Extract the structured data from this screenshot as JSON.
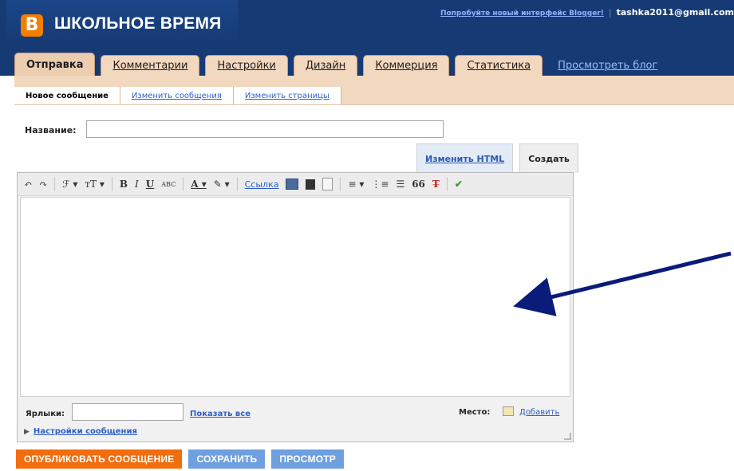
{
  "header": {
    "logo_letter": "B",
    "blog_title": "ШКОЛЬНОЕ ВРЕМЯ",
    "try_new_label": "Попробуйте новый интерфейс Blogger!",
    "separator": "|",
    "account_email": "tashka2011@gmail.com"
  },
  "tabs": [
    {
      "label": "Отправка",
      "active": true
    },
    {
      "label": "Комментарии"
    },
    {
      "label": "Настройки"
    },
    {
      "label": "Дизайн"
    },
    {
      "label": "Коммерция"
    },
    {
      "label": "Статистика"
    }
  ],
  "view_blog_label": "Просмотреть блог",
  "subtabs": [
    {
      "label": "Новое сообщение",
      "active": true
    },
    {
      "label": "Изменить сообщения"
    },
    {
      "label": "Изменить страницы"
    }
  ],
  "form": {
    "title_label": "Название:",
    "title_value": "",
    "mode_html_label": "Изменить HTML",
    "mode_compose_label": "Создать"
  },
  "toolbar": {
    "undo": "↶",
    "redo": "↷",
    "font": "ℱ ▾",
    "font_size": "тT ▾",
    "bold": "B",
    "italic": "I",
    "underline": "U",
    "strike": "ABC",
    "text_color": "A ▾",
    "highlight": "✎ ▾",
    "link_label": "Ссылка",
    "align": "≡ ▾",
    "ordered_list": "⋮≡",
    "unordered_list": "☰",
    "quote": "66",
    "remove_format": "T̶",
    "spellcheck": "✔"
  },
  "labels": {
    "label": "Ярлыки:",
    "value": "",
    "show_all": "Показать все",
    "place_label": "Место:",
    "place_add": "Добавить"
  },
  "post_options_label": "Настройки сообщения",
  "buttons": {
    "publish": "ОПУБЛИКОВАТЬ СООБЩЕНИЕ",
    "save": "СОХРАНИТЬ",
    "preview": "ПРОСМОТР"
  },
  "colors": {
    "header": "#163a74",
    "tab": "#f1d8bf",
    "publish": "#f26d0d",
    "secondary_button": "#6ea0e0",
    "link": "#2d5fc7",
    "arrow": "#0b1b7a"
  }
}
